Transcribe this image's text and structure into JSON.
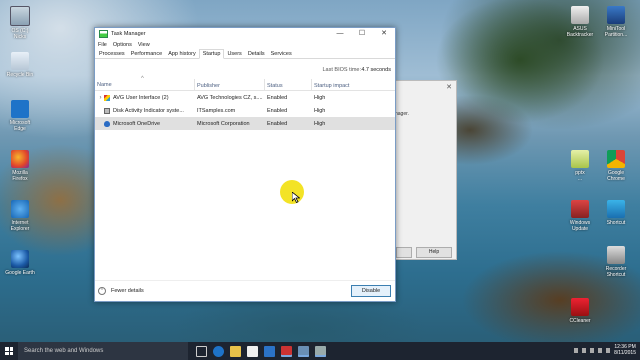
{
  "desktop": {
    "left_icons": [
      {
        "label_lines": [
          "OS (C:)",
          "Nicks"
        ],
        "icon": "drive-icon"
      },
      {
        "label_lines": [
          "Recycle Bin"
        ],
        "icon": "recycle-bin-icon"
      },
      {
        "label_lines": [
          "Microsoft",
          "Edge"
        ],
        "icon": "edge-icon"
      },
      {
        "label_lines": [
          "Mozilla",
          "Firefox"
        ],
        "icon": "firefox-icon"
      },
      {
        "label_lines": [
          "Internet",
          "Explorer"
        ],
        "icon": "ie-icon"
      },
      {
        "label_lines": [
          "Google Earth"
        ],
        "icon": "google-earth-icon"
      }
    ],
    "right_icons": [
      {
        "label_lines": [
          "ASUS",
          "Backtracker"
        ],
        "icon": "asus-icon"
      },
      {
        "label_lines": [
          "MiniTool",
          "Partition..."
        ],
        "icon": "minitool-icon"
      },
      {
        "label_lines": [
          "pptx",
          "..."
        ],
        "icon": "file-icon"
      },
      {
        "label_lines": [
          "Google",
          "Chrome"
        ],
        "icon": "chrome-icon"
      },
      {
        "label_lines": [
          "Windows",
          "Update"
        ],
        "icon": "tool-icon"
      },
      {
        "label_lines": [
          "Shortcut"
        ],
        "icon": "messenger-icon"
      },
      {
        "label_lines": [
          "Recorder",
          "Shortcut"
        ],
        "icon": "recorder-icon"
      },
      {
        "label_lines": [
          "CCleaner"
        ],
        "icon": "ccleaner-icon"
      }
    ]
  },
  "background_window": {
    "close": "✕",
    "text": "nager.",
    "help_label": "Help"
  },
  "task_manager": {
    "title": "Task Manager",
    "controls": {
      "minimize": "—",
      "maximize": "☐",
      "close": "✕"
    },
    "menu": [
      "File",
      "Options",
      "View"
    ],
    "tabs": [
      "Processes",
      "Performance",
      "App history",
      "Startup",
      "Users",
      "Details",
      "Services"
    ],
    "active_tab": "Startup",
    "bios_label": "Last BIOS time:",
    "bios_value": "4.7 seconds",
    "columns": [
      "Name",
      "Publisher",
      "Status",
      "Startup impact"
    ],
    "rows": [
      {
        "name": "AVG User Interface (2)",
        "publisher": "AVG Technologies CZ, s....",
        "status": "Enabled",
        "impact": "High",
        "expandable": true,
        "icon": "avg-icon"
      },
      {
        "name": "Disk Activity Indicator syste...",
        "publisher": "ITSamples.com",
        "status": "Enabled",
        "impact": "High",
        "expandable": false,
        "icon": "disk-icon"
      },
      {
        "name": "Microsoft OneDrive",
        "publisher": "Microsoft Corporation",
        "status": "Enabled",
        "impact": "High",
        "expandable": false,
        "icon": "onedrive-icon",
        "selected": true
      }
    ],
    "fewer_details": "Fewer details",
    "disable_button": "Disable"
  },
  "taskbar": {
    "search_placeholder": "Search the web and Windows",
    "time": "12:36 PM",
    "date": "8/11/2015"
  }
}
